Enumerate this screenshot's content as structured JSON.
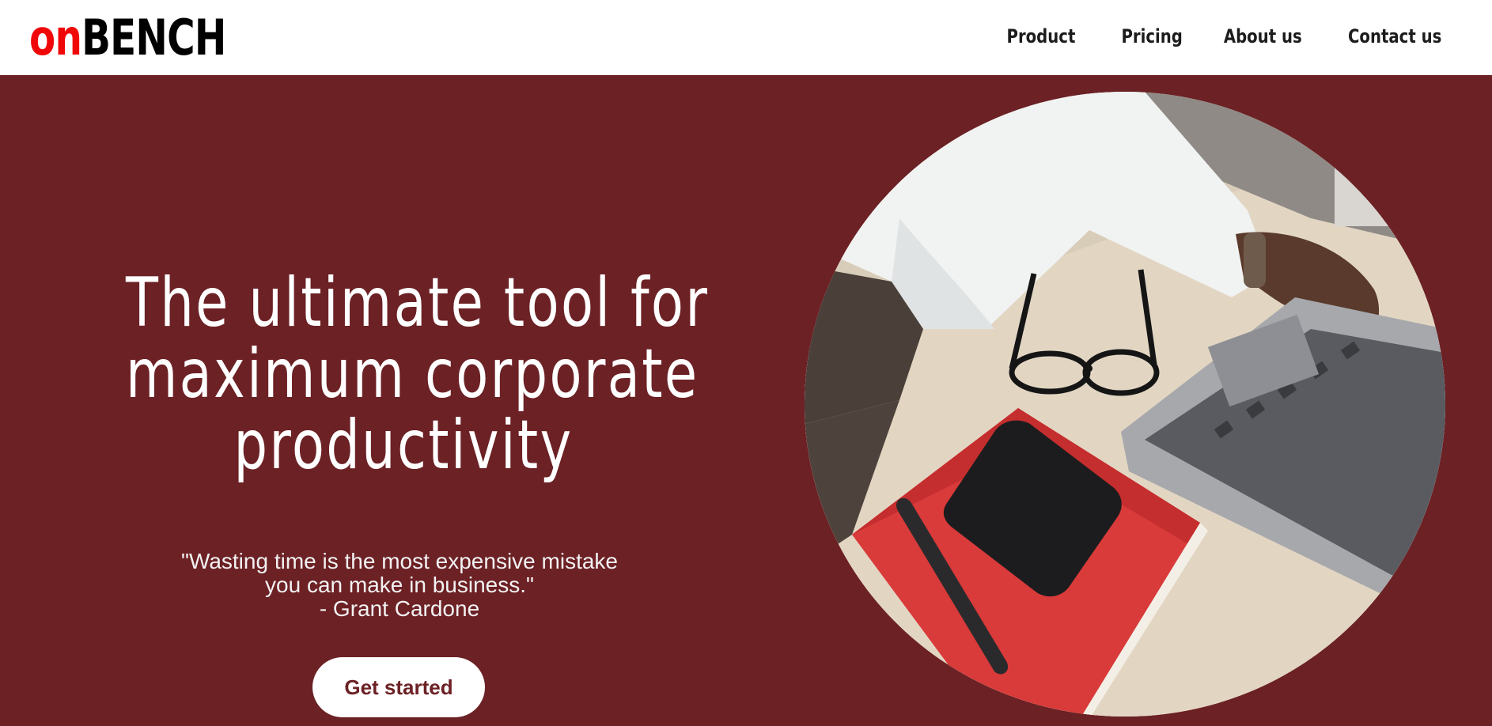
{
  "header": {
    "logo": {
      "part1": "on",
      "part2": "BENCH"
    },
    "nav": [
      {
        "label": "Product"
      },
      {
        "label": "Pricing"
      },
      {
        "label": "About us"
      },
      {
        "label": "Contact us"
      }
    ]
  },
  "hero": {
    "headline": [
      "The ultimate tool for",
      "maximum corporate",
      "productivity"
    ],
    "quote": {
      "line1": "\"Wasting time is the most expensive mistake",
      "line2": "you can make in business.\"",
      "author": "- Grant Cardone"
    },
    "cta_label": "Get started",
    "image_icon": "desk-workspace-photo"
  },
  "colors": {
    "brand_red": "#f00808",
    "hero_bg": "#6c2125",
    "button_text": "#6c2125",
    "white": "#ffffff"
  }
}
